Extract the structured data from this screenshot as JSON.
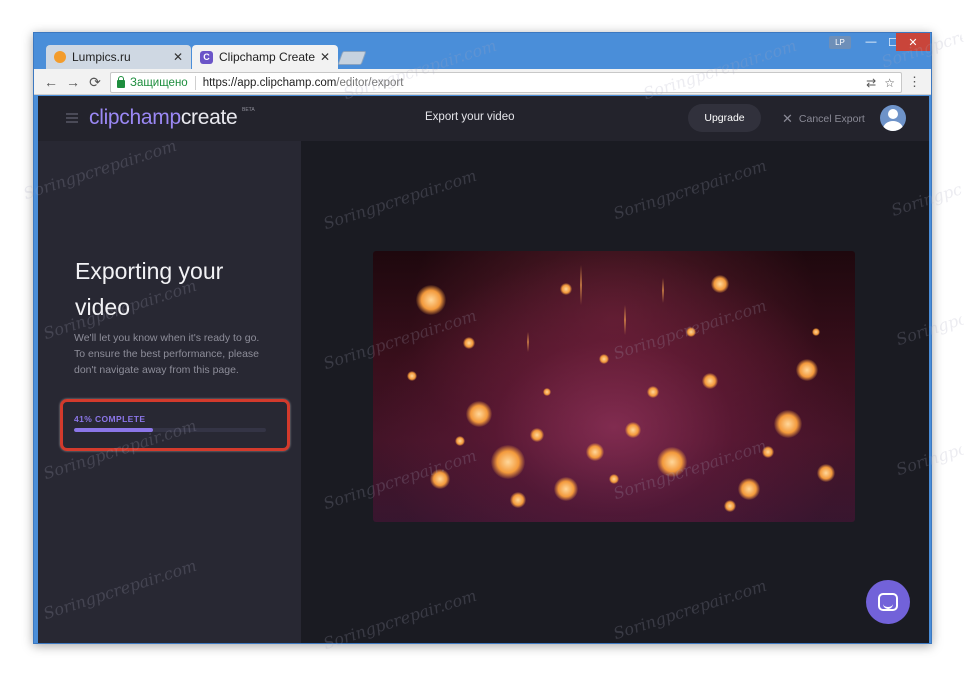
{
  "browser": {
    "tabs": [
      {
        "title": "Lumpics.ru",
        "icon": "orange-favicon-icon"
      },
      {
        "title": "Clipchamp Create",
        "icon": "clipchamp-favicon-icon",
        "icon_letter": "C"
      }
    ],
    "close_glyph": "✕",
    "profile_badge": "LP",
    "window_controls": {
      "minimize": "—",
      "maximize": "☐",
      "close": "✕"
    },
    "nav": {
      "back": "←",
      "forward": "→",
      "reload": "⟳"
    },
    "secure_label": "Защищено",
    "url_host": "https://app.clipchamp.com",
    "url_path": "/editor/export",
    "translate_glyph": "⇄",
    "star_glyph": "☆",
    "menu_glyph": "⋮"
  },
  "app": {
    "brand_clip": "clipchamp",
    "brand_create": "create",
    "brand_beta": "BETA",
    "header_title": "Export your video",
    "upgrade_label": "Upgrade",
    "cancel_label": "Cancel Export",
    "cancel_glyph": "✕"
  },
  "sidebar": {
    "title": "Exporting your video",
    "description_line1": "We'll let you know when it's ready to go.",
    "description_line2": "To ensure the best performance, please don't navigate away from this page.",
    "progress_label": "41% COMPLETE",
    "progress_fraction": 0.41
  },
  "watermark_text": "Soringpcrepair.com",
  "colors": {
    "accent": "#8b76e8",
    "highlight_border": "#d33a2c",
    "background": "#1a1b22",
    "sidebar": "#282833"
  }
}
